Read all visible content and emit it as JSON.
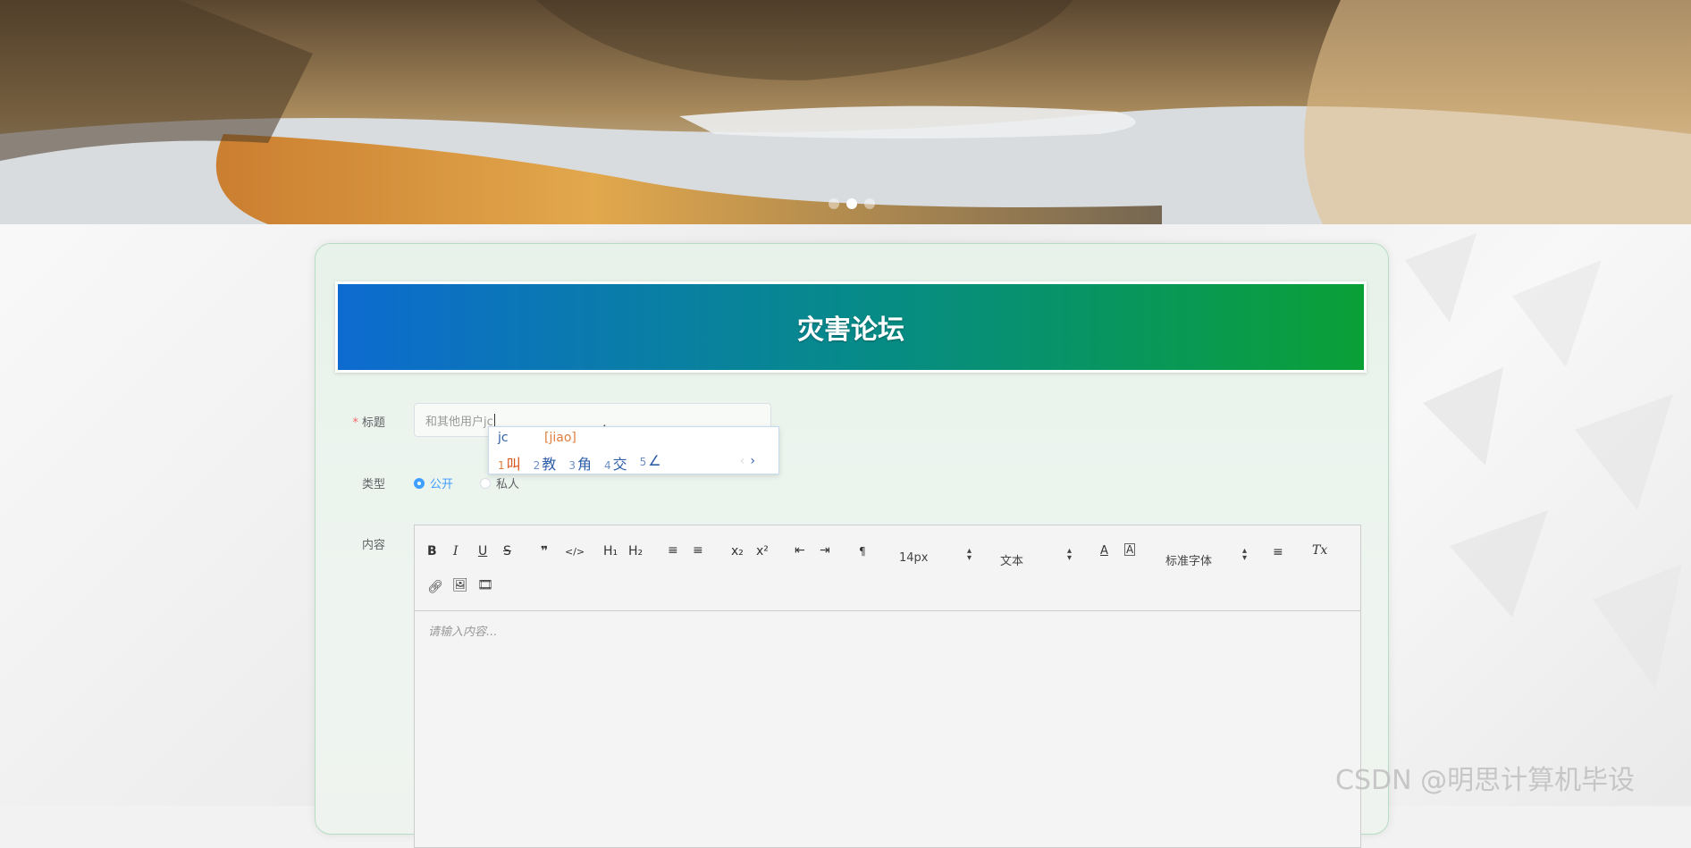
{
  "banner": {
    "carousel_dots": 3,
    "active_dot": 1
  },
  "form": {
    "heading": "灾害论坛",
    "title_label": "标题",
    "title_required_mark": "*",
    "title_value": "和其他用户jc",
    "type_label": "类型",
    "type_options": [
      "公开",
      "私人"
    ],
    "type_selected": "公开",
    "content_label": "内容",
    "content_placeholder": "请输入内容..."
  },
  "editor_toolbar": {
    "bold": "B",
    "italic": "I",
    "underline": "U",
    "strike": "S",
    "blockquote": "❞",
    "code": "</>",
    "h1": "H₁",
    "h2": "H₂",
    "ordered_list": "≡",
    "bullet_list": "≡",
    "subscript": "x₂",
    "superscript": "x²",
    "indent_decrease": "⇤",
    "indent_increase": "⇥",
    "direction": "¶",
    "size_value": "14px",
    "header_value": "文本",
    "font_value": "标准字体",
    "align": "≡",
    "clean": "Tx"
  },
  "ime": {
    "composition": "jc",
    "pinyin": "[jiao]",
    "candidates": [
      {
        "num": "1",
        "text": "叫"
      },
      {
        "num": "2",
        "text": "教"
      },
      {
        "num": "3",
        "text": "角"
      },
      {
        "num": "4",
        "text": "交"
      },
      {
        "num": "5",
        "text": "∠"
      }
    ],
    "prev": "‹",
    "next": "›"
  },
  "watermark": "CSDN @明思计算机毕设"
}
